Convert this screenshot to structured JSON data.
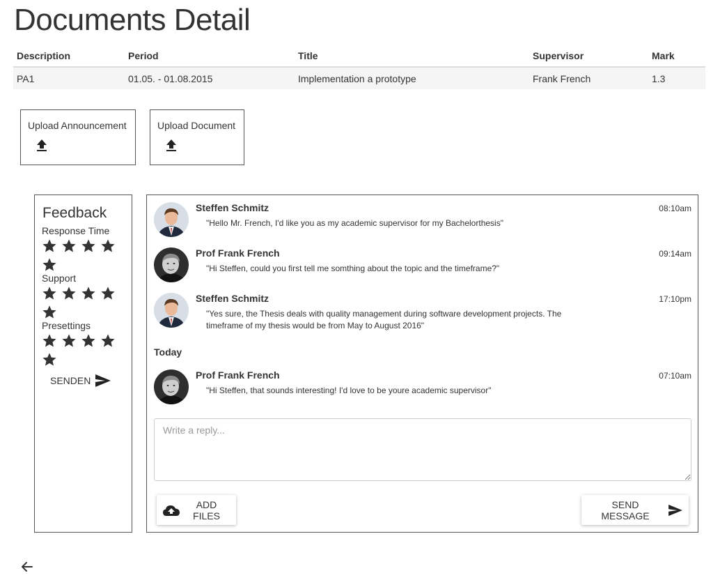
{
  "page": {
    "title": "Documents Detail"
  },
  "table": {
    "headers": [
      "Description",
      "Period",
      "Title",
      "Supervisor",
      "Mark"
    ],
    "rows": [
      [
        "PA1",
        "01.05. - 01.08.2015",
        "Implementation a prototype",
        "Frank French",
        "1.3"
      ]
    ]
  },
  "uploads": {
    "announcement_label": "Upload Announcement",
    "document_label": "Upload Document"
  },
  "feedback": {
    "title": "Feedback",
    "categories": [
      {
        "label": "Response Time",
        "stars": 5
      },
      {
        "label": "Support",
        "stars": 5
      },
      {
        "label": "Presettings",
        "stars": 5
      }
    ],
    "send_label": "SENDEN"
  },
  "chat": {
    "messages": [
      {
        "name": "Steffen Schmitz",
        "time": "08:10am",
        "text": "\"Hello Mr. French, I'd like you as my academic supervisor for my Bachelorthesis\"",
        "avatar": "student-avatar"
      },
      {
        "name": "Prof Frank French",
        "time": "09:14am",
        "text": "\"Hi Steffen, could you first tell me somthing about the topic and the timeframe?\"",
        "avatar": "professor-avatar"
      },
      {
        "name": "Steffen Schmitz",
        "time": "17:10pm",
        "text": "\"Yes sure, the Thesis deals with quality management during software development projects. The timeframe of my thesis would be from May to August 2016\"",
        "avatar": "student-avatar"
      }
    ],
    "day_separator": "Today",
    "today_messages": [
      {
        "name": "Prof Frank French",
        "time": "07:10am",
        "text": "\"Hi Steffen, that sounds interesting! I'd love to be youre academic supervisor\"",
        "avatar": "professor-avatar"
      }
    ],
    "reply_placeholder": "Write a reply...",
    "add_files_label": "ADD FILES",
    "send_message_label": "SEND MESSAGE"
  },
  "icons": {
    "upload": "upload-icon",
    "star": "star-icon",
    "send": "send-icon",
    "cloud_upload": "cloud-upload-icon",
    "back": "arrow-left-icon"
  }
}
